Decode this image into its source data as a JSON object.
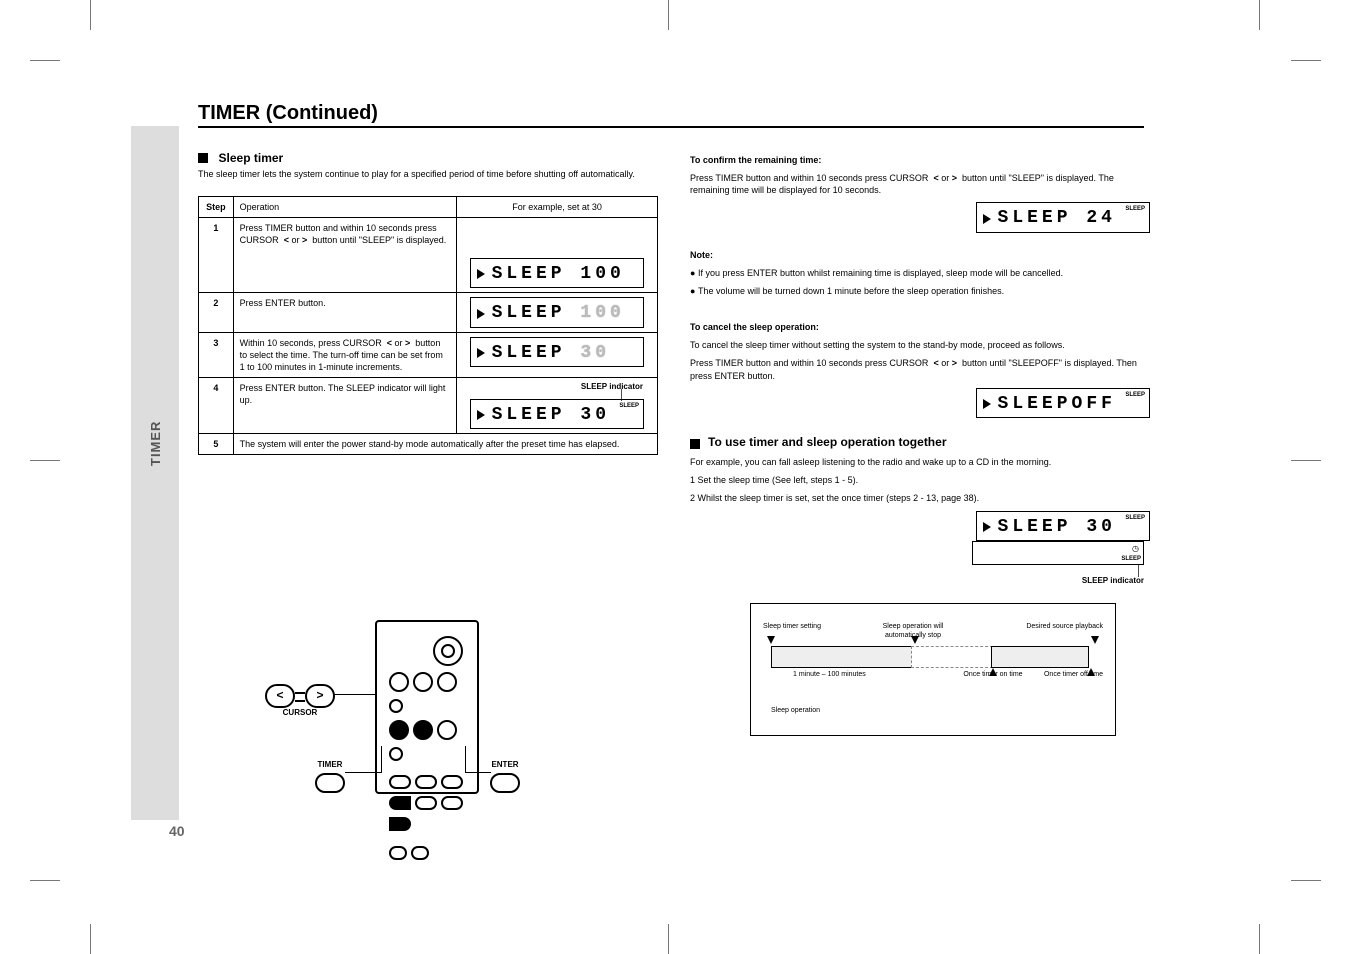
{
  "page_number": "40",
  "sidebar_label": "TIMER",
  "title": "TIMER (Continued)",
  "section": {
    "heading": "Sleep timer",
    "intro": "The sleep timer lets the system continue to play for a specified period of time before shutting off automatically."
  },
  "table": {
    "headers": {
      "step": "Step",
      "operation": "Operation",
      "display": "For example, set at 30"
    },
    "rows": [
      {
        "n": "1",
        "op_a": "Press TIMER button and within 10 seconds press CURSOR",
        "op_b": "or",
        "op_c": "button until \"SLEEP\" is displayed.",
        "lcd": "SLEEP 100"
      },
      {
        "n": "2",
        "op_a": "Press ENTER button.",
        "lcd": "SLEEP 100",
        "dim": true
      },
      {
        "n": "3",
        "op_a": "Within 10 seconds, press CURSOR",
        "op_b": "or",
        "op_c": "button to select the time. The turn-off time can be set from 1 to 100 minutes in 1-minute increments.",
        "lcd": "SLEEP  30",
        "dim": true
      },
      {
        "n": "4",
        "op_a": "Press ENTER button. The SLEEP indicator will light up.",
        "lcd": "SLEEP  30",
        "callout": "SLEEP indicator",
        "ind": "SLEEP"
      },
      {
        "n": "5",
        "op_a": "The system will enter the power stand-by mode automatically after the preset time has elapsed."
      }
    ]
  },
  "right": {
    "check_title": "To confirm the remaining time:",
    "check_a": "Press TIMER button and within 10 seconds press CURSOR",
    "check_b": "or",
    "check_c": "button until \"SLEEP\" is displayed. The remaining time will be displayed for 10 seconds.",
    "check_lcd": "SLEEP  24",
    "notes_title": "Note:",
    "note1": "If you press ENTER button whilst remaining time is displayed, sleep mode will be cancelled.",
    "note2": "The volume will be turned down 1 minute before the sleep operation finishes.",
    "cancel_title": "To cancel the sleep operation:",
    "cancel_a": "To cancel the sleep timer without setting the system to the stand-by mode, proceed as follows.",
    "cancel_b": "Press TIMER button and within 10 seconds press CURSOR",
    "cancel_c": "or",
    "cancel_d": "button until \"SLEEPOFF\" is displayed. Then press ENTER button.",
    "cancel_lcd": "SLEEPOFF",
    "combo_title": "To use timer and sleep operation together",
    "combo_body": "For example, you can fall asleep listening to the radio and wake up to a CD in the morning.",
    "combo_step1": "1  Set the sleep time (See left, steps 1 - 5).",
    "combo_step2": "2  Whilst the sleep timer is set, set the once timer (steps 2 - 13, page 38).",
    "combo_lcd": "SLEEP  30",
    "combo_callout_small": "SLEEP indicator",
    "diagram": {
      "sleep_setting": "Sleep timer setting",
      "auto_off": "Sleep operation will automatically stop",
      "playback": "Desired source playback",
      "once_time": "Once timer on time",
      "once_off": "Once timer off time",
      "interval": "1 minute – 100 minutes",
      "range": "Sleep operation"
    }
  },
  "remote": {
    "cursor": "CURSOR",
    "timer": "TIMER",
    "enter": "ENTER",
    "lt": "<",
    "gt": ">"
  }
}
